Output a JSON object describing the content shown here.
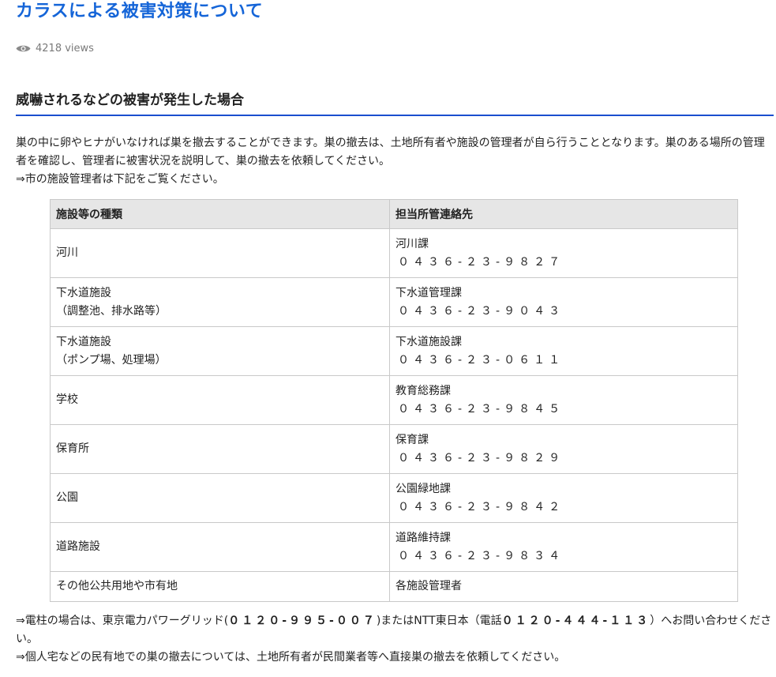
{
  "page": {
    "title": "カラスによる被害対策について",
    "views": "4218 views",
    "section_heading": "威嚇されるなどの被害が発生した場合",
    "intro_lines": [
      "巣の中に卵やヒナがいなければ巣を撤去することができます。巣の撤去は、土地所有者や施設の管理者が自ら行うこととなります。巣のある場所の管理者を確認し、管理者に被害状況を説明して、巣の撤去を依頼してください。",
      "⇒市の施設管理者は下記をご覧ください。"
    ]
  },
  "table": {
    "headers": [
      "施設等の種類",
      "担当所管連絡先"
    ],
    "rows": [
      {
        "type": "河川",
        "type_sub": "",
        "dept": "河川課",
        "phone": "０４３６-２３-９８２７"
      },
      {
        "type": "下水道施設",
        "type_sub": "（調整池、排水路等）",
        "dept": "下水道管理課",
        "phone": "０４３６-２３-９０４３"
      },
      {
        "type": "下水道施設",
        "type_sub": "（ポンプ場、処理場）",
        "dept": "下水道施設課",
        "phone": "０４３６-２３-０６１１"
      },
      {
        "type": "学校",
        "type_sub": "",
        "dept": "教育総務課",
        "phone": "０４３６-２３-９８４５"
      },
      {
        "type": "保育所",
        "type_sub": "",
        "dept": "保育課",
        "phone": "０４３６-２３-９８２９"
      },
      {
        "type": "公園",
        "type_sub": "",
        "dept": "公園緑地課",
        "phone": "０４３６-２３-９８４２"
      },
      {
        "type": "道路施設",
        "type_sub": "",
        "dept": "道路維持課",
        "phone": "０４３６-２３-９８３４"
      },
      {
        "type": "その他公共用地や市有地",
        "type_sub": "",
        "dept": "各施設管理者",
        "phone": ""
      }
    ]
  },
  "footer": {
    "line1_pre": "⇒電柱の場合は、東京電力パワーグリッド(",
    "line1_num1": "０１２０-９９５-００７",
    "line1_mid": ")またはNTT東日本（電話",
    "line1_num2": "０１２０-４４４-１１３",
    "line1_post": "）へお問い合わせください。",
    "line2": "⇒個人宅などの民有地での巣の撤去については、土地所有者が民間業者等へ直接巣の撤去を依頼してください。"
  },
  "icons": {
    "views": "eye-icon"
  },
  "colors": {
    "title": "#1565d8",
    "heading_rule": "#1b4fcf",
    "table_header_bg": "#e6e6e6",
    "table_border": "#c9c9c9"
  }
}
